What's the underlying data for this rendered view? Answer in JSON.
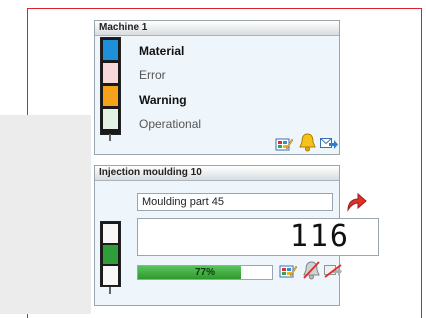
{
  "machine_panel": {
    "title": "Machine 1",
    "statuses": [
      {
        "label": "Material",
        "bold": true,
        "color": "#1e8fd8"
      },
      {
        "label": "Error",
        "bold": false,
        "color": "#f7d9dc"
      },
      {
        "label": "Warning",
        "bold": true,
        "color": "#f5a21a"
      },
      {
        "label": "Operational",
        "bold": false,
        "color": "#e4f2e4"
      }
    ],
    "icons": [
      "edit-icon",
      "alarm-bell-icon",
      "send-message-icon"
    ]
  },
  "injection_panel": {
    "title": "Injection moulding 10",
    "part_name": "Moulding part 45",
    "counter": "116",
    "progress": {
      "value": 0.77,
      "label": "77%"
    },
    "light_colors": [
      "#f7f7f7",
      "#2f9e3a",
      "#f7f7f7"
    ],
    "icons": [
      "forward-arrow-icon",
      "edit-icon",
      "alarm-muted-icon",
      "send-disabled-icon"
    ]
  }
}
